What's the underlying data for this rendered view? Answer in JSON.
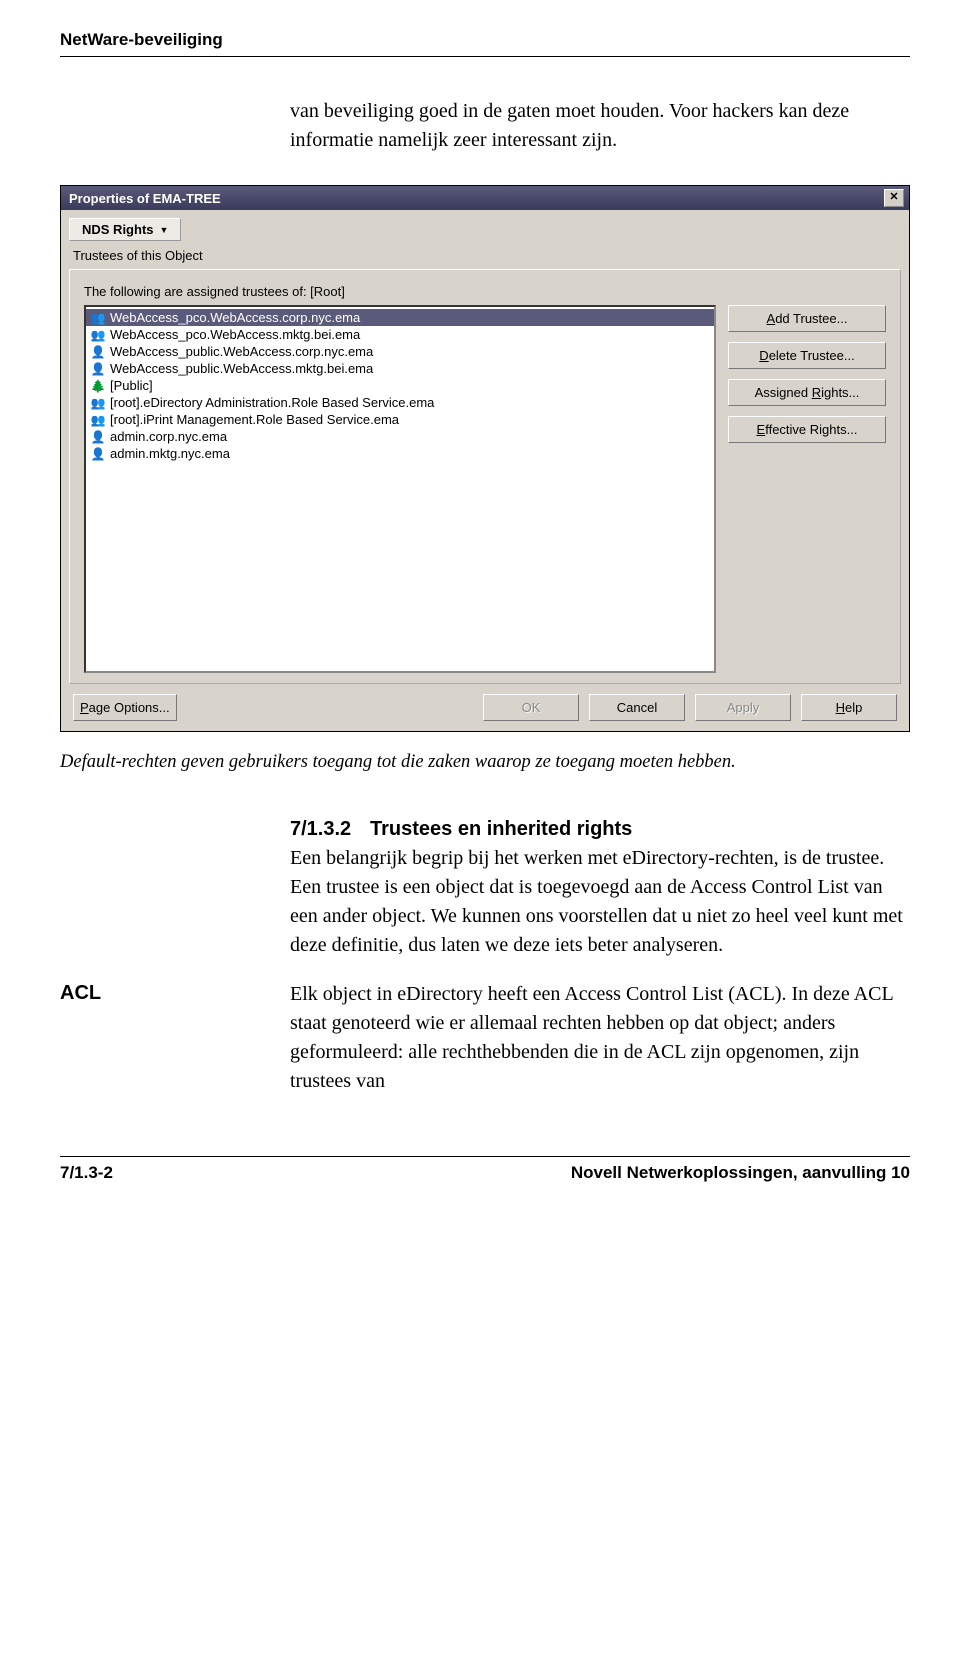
{
  "header": {
    "running": "NetWare-beveiliging"
  },
  "intro": {
    "p1": "van beveiliging goed in de gaten moet houden. Voor hackers kan deze informatie namelijk zeer interessant zijn."
  },
  "dialog": {
    "title": "Properties of EMA-TREE",
    "close_glyph": "✕",
    "tab": {
      "label": "NDS Rights",
      "arrow": "▼"
    },
    "subtab": "Trustees of this Object",
    "panel_label": "The following are assigned trustees of: [Root]",
    "list": [
      {
        "icon": "role",
        "text": "WebAccess_pco.WebAccess.corp.nyc.ema",
        "selected": true
      },
      {
        "icon": "role",
        "text": "WebAccess_pco.WebAccess.mktg.bei.ema"
      },
      {
        "icon": "user",
        "text": "WebAccess_public.WebAccess.corp.nyc.ema"
      },
      {
        "icon": "user",
        "text": "WebAccess_public.WebAccess.mktg.bei.ema"
      },
      {
        "icon": "tree",
        "text": "[Public]"
      },
      {
        "icon": "role",
        "text": "[root].eDirectory Administration.Role Based Service.ema"
      },
      {
        "icon": "role",
        "text": "[root].iPrint Management.Role Based Service.ema"
      },
      {
        "icon": "user",
        "text": "admin.corp.nyc.ema"
      },
      {
        "icon": "user",
        "text": "admin.mktg.nyc.ema"
      }
    ],
    "buttons": {
      "add": "Add Trustee...",
      "delete": "Delete Trustee...",
      "assigned": "Assigned Rights...",
      "effective": "Effective Rights..."
    },
    "bottom": {
      "page_options": "Page Options...",
      "ok": "OK",
      "cancel": "Cancel",
      "apply": "Apply",
      "help": "Help"
    }
  },
  "caption": "Default-rechten geven gebruikers toegang tot die zaken waarop ze toegang moeten hebben.",
  "section": {
    "num": "7/1.3.2",
    "title": "Trustees en inherited rights",
    "body1": "Een belangrijk begrip bij het werken met eDirectory-rechten, is de trustee. Een trustee is een object dat is toegevoegd aan de Access Control List van een ander object. We kunnen ons voorstellen dat u niet zo heel veel kunt met deze definitie, dus laten we deze iets beter analyseren.",
    "margin_label": "ACL",
    "body2": "Elk object in eDirectory heeft een Access Control List (ACL). In deze ACL staat genoteerd wie er allemaal rechten hebben op dat object; anders geformuleerd: alle rechthebbenden die in de ACL zijn opgenomen, zijn trustees van"
  },
  "footer": {
    "left": "7/1.3-2",
    "right": "Novell Netwerkoplossingen, aanvulling 10"
  }
}
